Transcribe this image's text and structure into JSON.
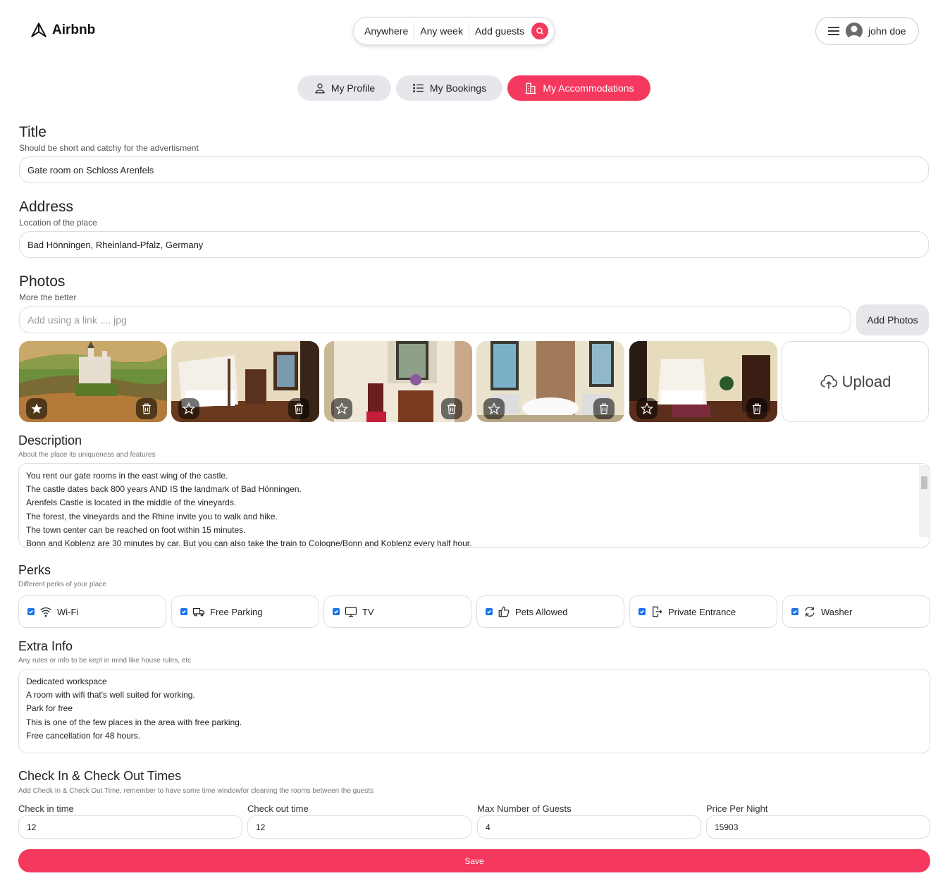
{
  "header": {
    "brand": "Airbnb",
    "search": {
      "where": "Anywhere",
      "when": "Any week",
      "guests": "Add guests"
    },
    "user": {
      "name": "john doe"
    }
  },
  "tabs": [
    {
      "label": "My Profile",
      "icon": "user-icon",
      "active": false
    },
    {
      "label": "My Bookings",
      "icon": "list-icon",
      "active": false
    },
    {
      "label": "My Accommodations",
      "icon": "building-icon",
      "active": true
    }
  ],
  "form": {
    "title": {
      "heading": "Title",
      "hint": "Should be short and catchy for the advertisment",
      "value": "Gate room on Schloss Arenfels"
    },
    "address": {
      "heading": "Address",
      "hint": "Location of the place",
      "value": "Bad Hönningen, Rheinland-Pfalz, Germany"
    },
    "photos": {
      "heading": "Photos",
      "hint": "More the better",
      "link_placeholder": "Add using a link .... jpg",
      "add_label": "Add Photos",
      "upload_label": "Upload",
      "items": [
        {
          "subject": "castle aerial view",
          "main": true
        },
        {
          "subject": "canopy bedroom",
          "main": false
        },
        {
          "subject": "antique desk and chair",
          "main": false
        },
        {
          "subject": "bathroom with tub",
          "main": false
        },
        {
          "subject": "bedroom with wardrobe",
          "main": false
        }
      ]
    },
    "description": {
      "heading": "Description",
      "hint": "About the place its uniqueness and features",
      "lines": [
        "You rent our gate rooms in the east wing of the castle.",
        "The castle dates back 800 years AND IS the landmark of Bad Hönningen.",
        "Arenfels Castle is located in the middle of the vineyards.",
        "The forest, the vineyards and the Rhine invite you to walk and hike.",
        "The town center can be reached on foot within 15 minutes.",
        "Bonn and Koblenz are 30 minutes by car. But you can also take the train to Cologne/Bonn and Koblenz every half hour."
      ]
    },
    "perks": {
      "heading": "Perks",
      "hint": "Different perks of your place",
      "items": [
        {
          "label": "Wi-Fi",
          "icon": "wifi-icon",
          "checked": true
        },
        {
          "label": "Free Parking",
          "icon": "truck-icon",
          "checked": true
        },
        {
          "label": "TV",
          "icon": "tv-icon",
          "checked": true
        },
        {
          "label": "Pets Allowed",
          "icon": "thumbs-up-icon",
          "checked": true
        },
        {
          "label": "Private Entrance",
          "icon": "door-exit-icon",
          "checked": true
        },
        {
          "label": "Washer",
          "icon": "refresh-icon",
          "checked": true
        }
      ]
    },
    "extra": {
      "heading": "Extra Info",
      "hint": "Any rules or info to be kept in mind like house rules, etc",
      "lines": [
        "Dedicated workspace",
        "A room with wifi that's well suited for working.",
        "Park for free",
        "This is one of the few places in the area with free parking.",
        "Free cancellation for 48 hours."
      ]
    },
    "times": {
      "heading": "Check In & Check Out Times",
      "hint": "Add Check In & Check Out Time, remember to have some time windowfor cleaning the rooms between the guests",
      "checkin": {
        "label": "Check in time",
        "value": "12"
      },
      "checkout": {
        "label": "Check out time",
        "value": "12"
      },
      "guests": {
        "label": "Max Number of Guests",
        "value": "4"
      },
      "price": {
        "label": "Price Per Night",
        "value": "15903"
      }
    },
    "save_label": "Save"
  },
  "colors": {
    "accent": "#f5385d",
    "tab_bg": "#e5e7eb",
    "checkbox": "#1a73e8"
  }
}
